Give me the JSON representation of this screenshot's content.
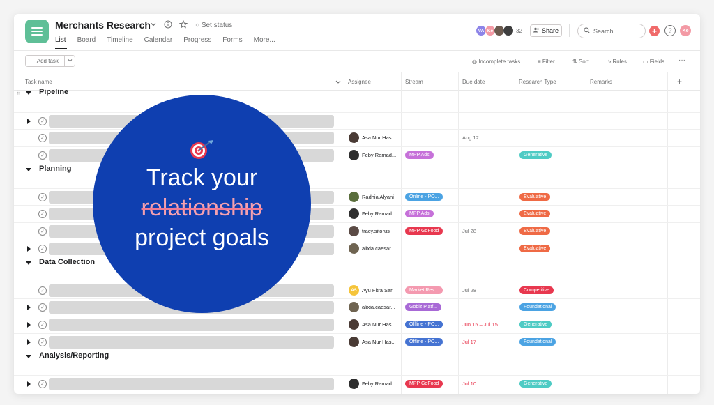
{
  "header": {
    "title": "Merchants Research",
    "set_status": "Set status",
    "tabs": [
      "List",
      "Board",
      "Timeline",
      "Calendar",
      "Progress",
      "Forms",
      "More..."
    ],
    "members": [
      {
        "initials": "VA",
        "color": "#8d84e8"
      },
      {
        "initials": "Ke",
        "color": "#f39aa5"
      },
      {
        "initials": "",
        "color": "#6b5a4e"
      },
      {
        "initials": "",
        "color": "#3e3e3e"
      }
    ],
    "member_count": "32",
    "share_label": "Share",
    "search_placeholder": "Search",
    "add_label": "+",
    "help_label": "?",
    "user_initials": "Ke"
  },
  "toolbar": {
    "add_task": "Add task",
    "incomplete": "Incomplete tasks",
    "filter": "Filter",
    "sort": "Sort",
    "rules": "Rules",
    "fields": "Fields",
    "more": "···"
  },
  "columns": {
    "task_name": "Task name",
    "assignee": "Assignee",
    "stream": "Stream",
    "due_date": "Due date",
    "research_type": "Research Type",
    "remarks": "Remarks",
    "add": "+"
  },
  "sections": [
    {
      "title": "Pipeline",
      "rows": [
        {
          "expand": true,
          "assignee": "",
          "av_color": "",
          "stream": "",
          "stream_color": "",
          "date": "",
          "date_color": "",
          "type": "",
          "type_color": ""
        },
        {
          "expand": false,
          "assignee": "Asa Nur Has...",
          "av_color": "#4a3b35",
          "stream": "",
          "stream_color": "",
          "date": "Aug 12",
          "date_color": "#6d6e6f",
          "type": "",
          "type_color": ""
        },
        {
          "expand": false,
          "assignee": "Feby Ramad...",
          "av_color": "#2f2f2f",
          "stream": "MPP Ads",
          "stream_color": "#c671d9",
          "date": "",
          "date_color": "",
          "type": "Generative",
          "type_color": "#4ecbc4"
        }
      ]
    },
    {
      "title": "Planning",
      "rows": [
        {
          "expand": false,
          "assignee": "Radhia Alyani",
          "av_color": "#5a6e3c",
          "stream": "Online - PO...",
          "stream_color": "#4ba3e3",
          "date": "",
          "date_color": "",
          "type": "Evaluative",
          "type_color": "#ef6a45"
        },
        {
          "expand": false,
          "assignee": "Feby Ramad...",
          "av_color": "#2f2f2f",
          "stream": "MPP Ads",
          "stream_color": "#c671d9",
          "date": "",
          "date_color": "",
          "type": "Evaluative",
          "type_color": "#ef6a45"
        },
        {
          "expand": false,
          "assignee": "tracy.sitorus",
          "av_color": "#5b4b45",
          "stream": "MPP GoFood",
          "stream_color": "#e8384f",
          "date": "Jul 28",
          "date_color": "#6d6e6f",
          "type": "Evaluative",
          "type_color": "#ef6a45"
        },
        {
          "expand": true,
          "assignee": "alixia.caesar...",
          "av_color": "#6f6451",
          "stream": "",
          "stream_color": "",
          "date": "",
          "date_color": "",
          "type": "Evaluative",
          "type_color": "#ef6a45"
        }
      ]
    },
    {
      "title": "Data Collection",
      "rows": [
        {
          "expand": false,
          "assignee": "Ayu Fitra Sari",
          "av_initials": "AS",
          "av_color": "#f5c43a",
          "stream": "Market Res...",
          "stream_color": "#f49ab0",
          "date": "Jul 28",
          "date_color": "#6d6e6f",
          "type": "Competitive",
          "type_color": "#e8384f"
        },
        {
          "expand": true,
          "assignee": "alixia.caesar...",
          "av_color": "#6f6451",
          "stream": "Gobiz Platf...",
          "stream_color": "#a869d6",
          "date": "",
          "date_color": "",
          "type": "Foundational",
          "type_color": "#4ba3e3"
        },
        {
          "expand": true,
          "assignee": "Asa Nur Has...",
          "av_color": "#4a3b35",
          "stream": "Offline - PO...",
          "stream_color": "#4573d2",
          "date": "Jun 15 – Jul 15",
          "date_color": "#e8384f",
          "type": "Generative",
          "type_color": "#4ecbc4"
        },
        {
          "expand": true,
          "assignee": "Asa Nur Has...",
          "av_color": "#4a3b35",
          "stream": "Offline - PO...",
          "stream_color": "#4573d2",
          "date": "Jul 17",
          "date_color": "#e8384f",
          "type": "Foundational",
          "type_color": "#4ba3e3"
        }
      ]
    },
    {
      "title": "Analysis/Reporting",
      "rows": [
        {
          "expand": true,
          "assignee": "Feby Ramad...",
          "av_color": "#2f2f2f",
          "stream": "MPP GoFood",
          "stream_color": "#e8384f",
          "date": "Jul 10",
          "date_color": "#e8384f",
          "type": "Generative",
          "type_color": "#4ecbc4"
        }
      ]
    }
  ],
  "overlay": {
    "line1": "Track your",
    "line2_struck": "relationship",
    "line3": "project goals",
    "icon": "target-icon"
  }
}
